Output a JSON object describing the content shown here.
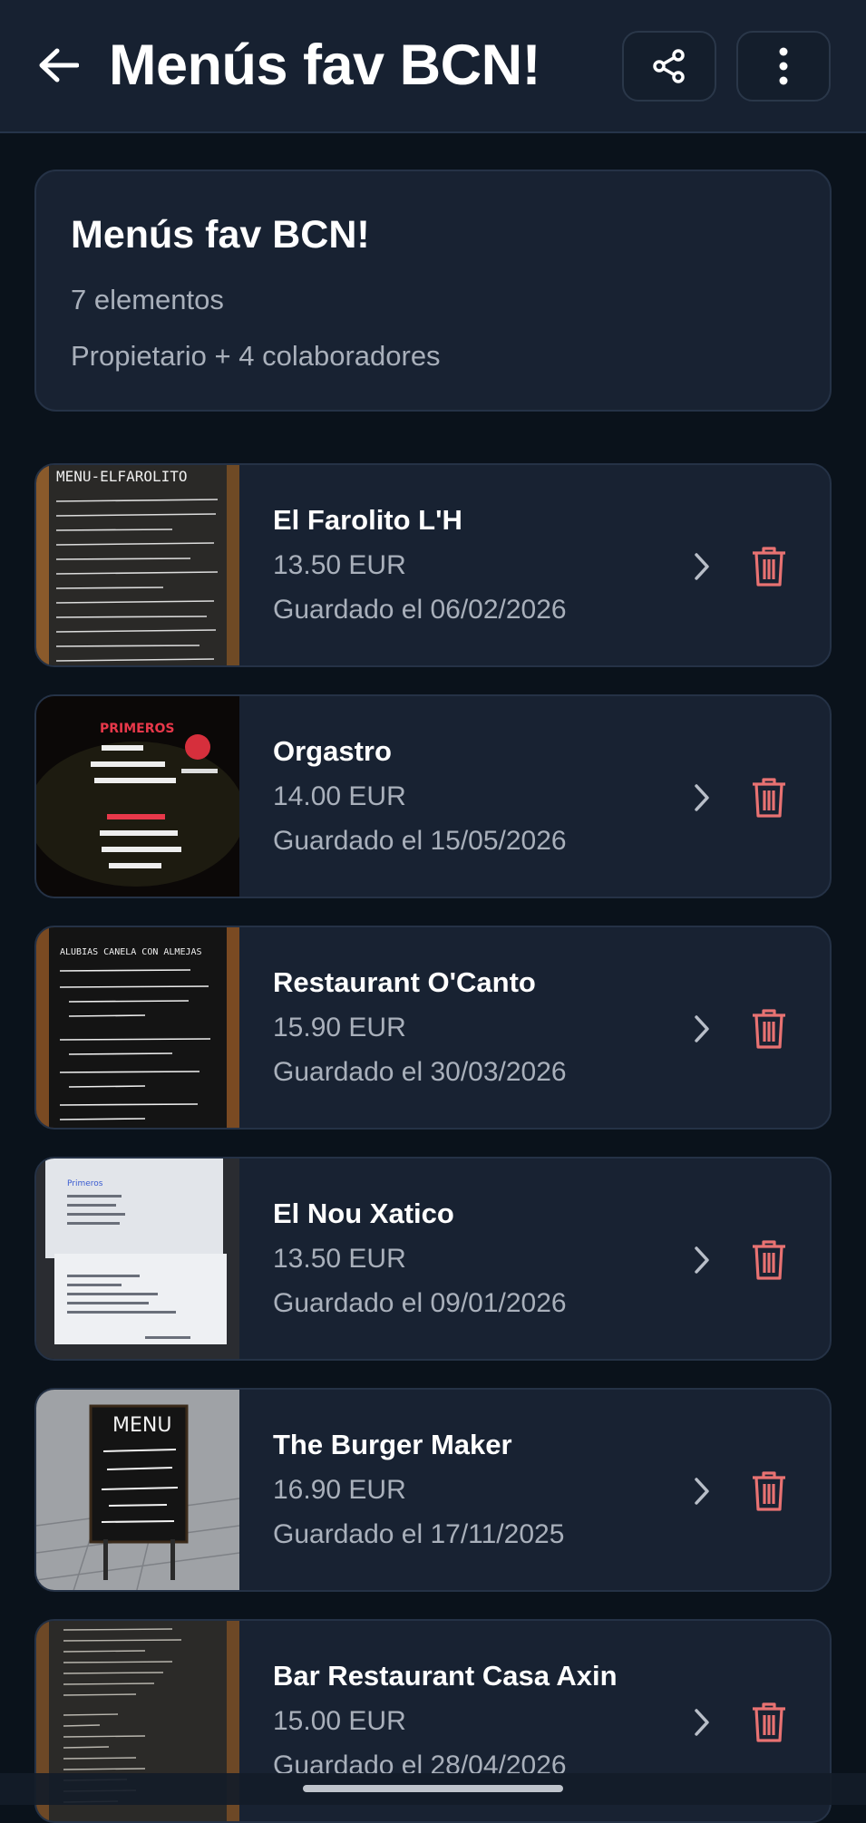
{
  "header": {
    "title": "Menús fav BCN!",
    "back_icon": "arrow-left-icon",
    "share_icon": "share-icon",
    "more_icon": "more-vertical-icon"
  },
  "summary": {
    "title": "Menús fav BCN!",
    "count": "7 elementos",
    "collaborators": "Propietario + 4 colaboradores"
  },
  "items": [
    {
      "name": "El Farolito L'H",
      "price": "13.50 EUR",
      "date": "Guardado el 06/02/2026",
      "thumb_text": "MENU-ELFAROLITO"
    },
    {
      "name": "Orgastro",
      "price": "14.00 EUR",
      "date": "Guardado el 15/05/2026",
      "thumb_text": "PRIMEROS"
    },
    {
      "name": "Restaurant O'Canto",
      "price": "15.90 EUR",
      "date": "Guardado el 30/03/2026",
      "thumb_text": "ALUBIAS CANELA CON ALMEJAS"
    },
    {
      "name": "El Nou Xatico",
      "price": "13.50 EUR",
      "date": "Guardado el 09/01/2026",
      "thumb_text": "Primeros"
    },
    {
      "name": "The Burger Maker",
      "price": "16.90 EUR",
      "date": "Guardado el 17/11/2025",
      "thumb_text": "MENU"
    },
    {
      "name": "Bar Restaurant Casa Axin",
      "price": "15.00 EUR",
      "date": "Guardado el 28/04/2026",
      "thumb_text": ""
    }
  ],
  "colors": {
    "background": "#0a121b",
    "card": "#182232",
    "delete": "#e87272",
    "muted_text": "#a9b0bb"
  }
}
